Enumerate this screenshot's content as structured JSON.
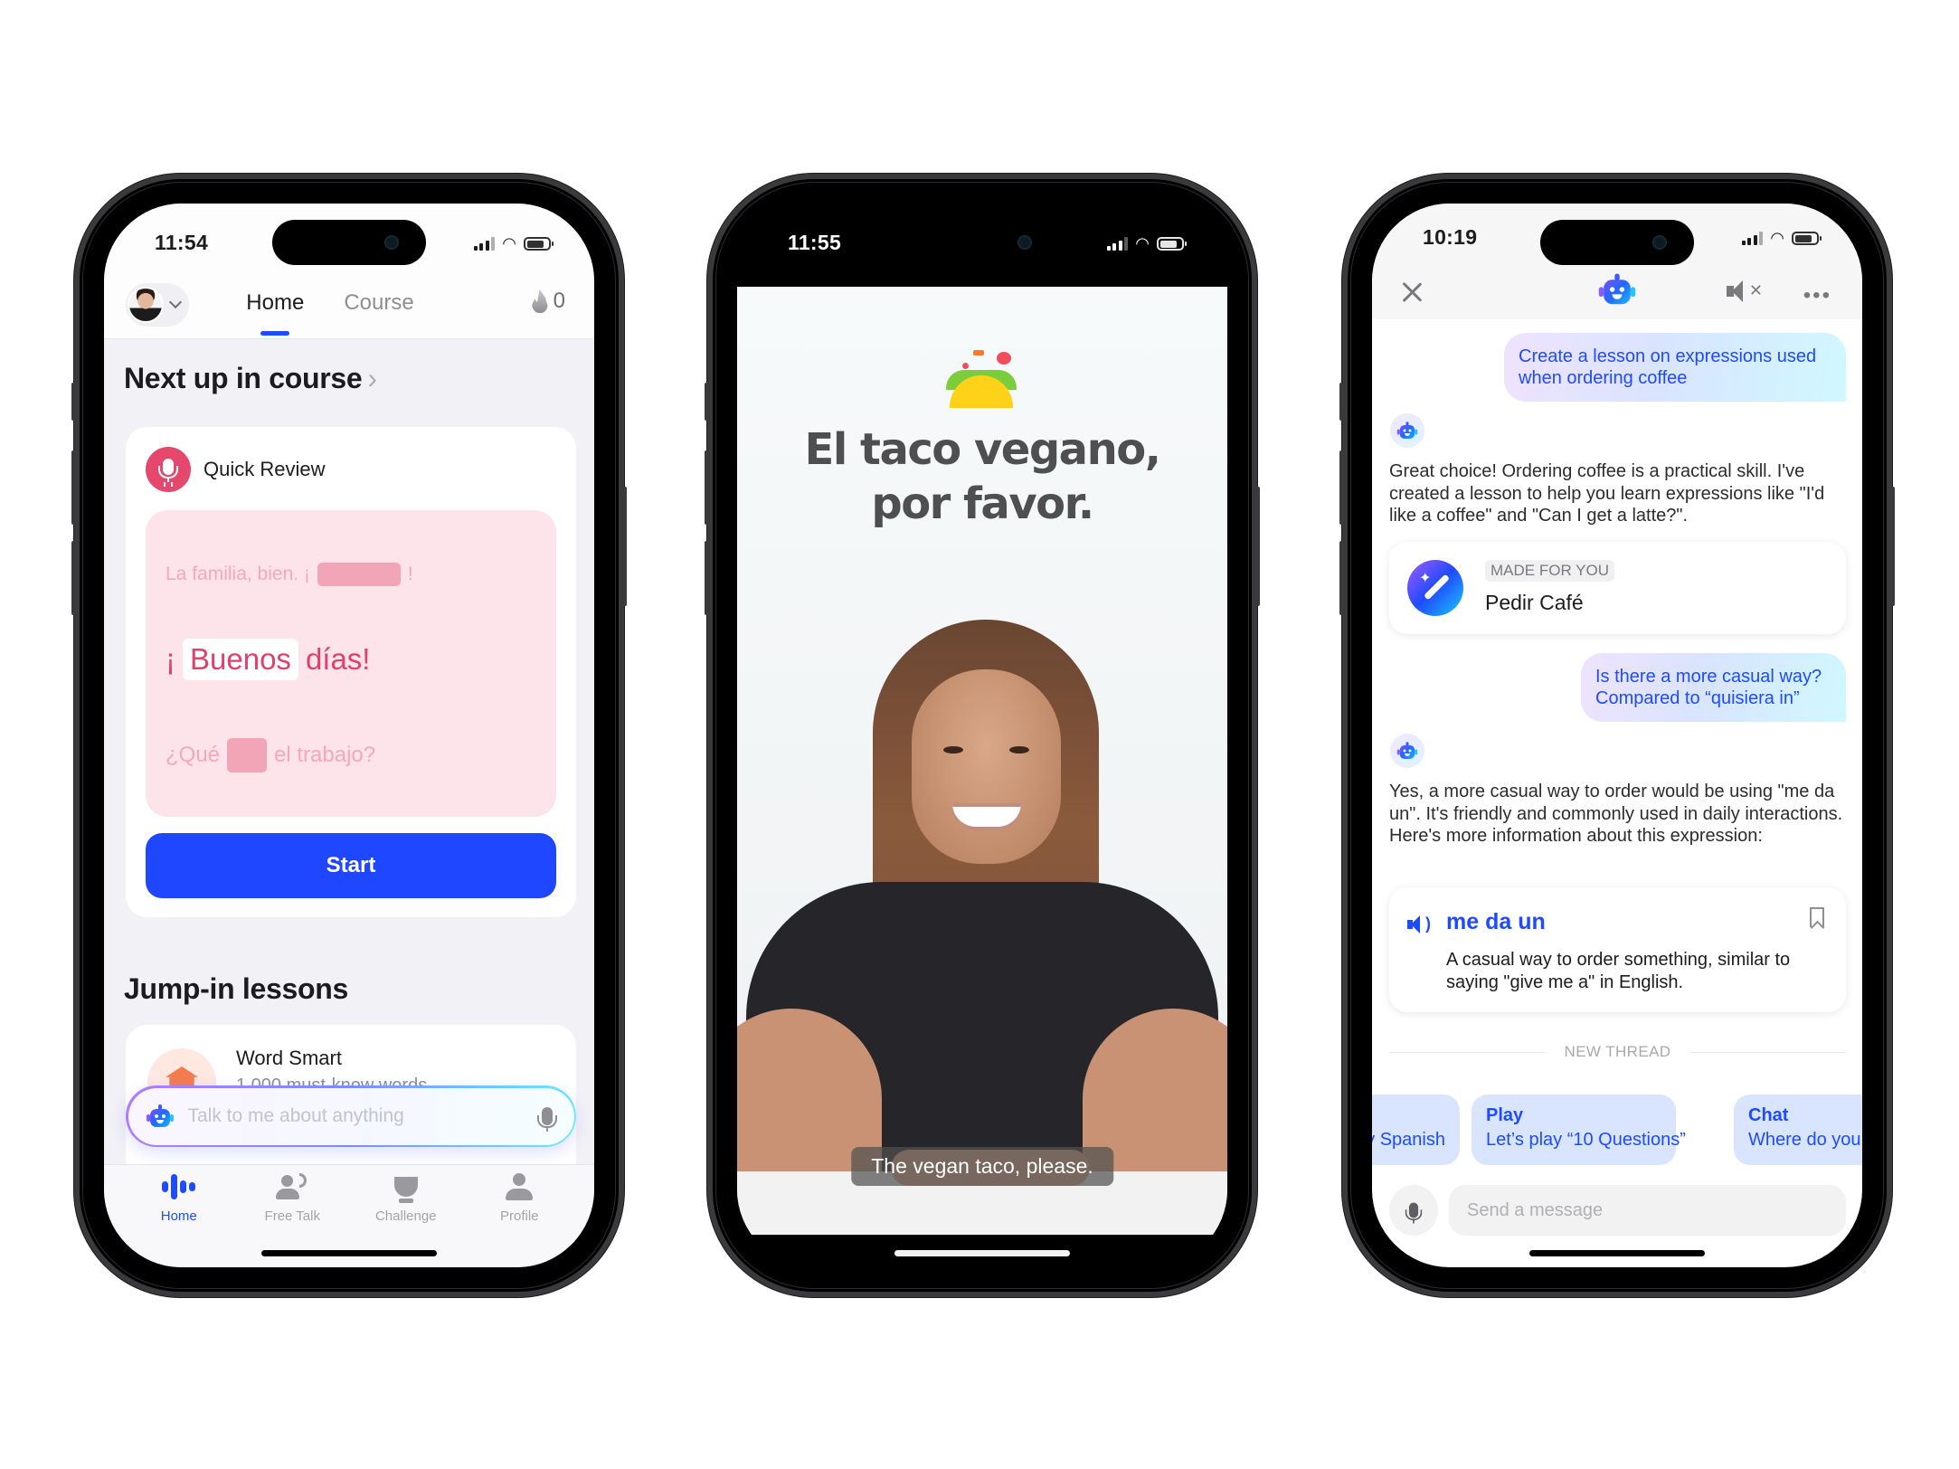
{
  "phones": [
    {
      "status": {
        "time": "11:54"
      },
      "header": {
        "tabs": [
          {
            "label": "Home",
            "active": true
          },
          {
            "label": "Course",
            "active": false
          }
        ],
        "streak_count": "0"
      },
      "next_up": {
        "title": "Next up in course",
        "arrow": "›",
        "card": {
          "label": "Quick Review",
          "line_prev": {
            "before": "La familia, bien. ¡",
            "after": "!"
          },
          "line_main": {
            "before": "¡",
            "word": "Buenos",
            "after": "días!"
          },
          "line_next": {
            "before": "¿Qué",
            "after": "el trabajo?"
          },
          "start_label": "Start"
        }
      },
      "jump_in": {
        "title": "Jump-in lessons",
        "items": [
          {
            "title": "Word Smart",
            "subtitle": "1,000 must-know words"
          }
        ]
      },
      "talk_input": {
        "placeholder": "Talk to me about anything"
      },
      "tabbar": [
        {
          "label": "Home",
          "icon": "waveform-icon",
          "active": true
        },
        {
          "label": "Free Talk",
          "icon": "speaking-person-icon",
          "active": false
        },
        {
          "label": "Challenge",
          "icon": "trophy-icon",
          "active": false
        },
        {
          "label": "Profile",
          "icon": "person-icon",
          "active": false
        }
      ]
    },
    {
      "status": {
        "time": "11:55"
      },
      "video": {
        "emoji": "taco-icon",
        "title_line1": "El taco vegano,",
        "title_line2": "por favor.",
        "caption": "The vegan taco, please."
      }
    },
    {
      "status": {
        "time": "10:19"
      },
      "header": {
        "close": "close-icon",
        "mute": "mute-icon",
        "more": "•••"
      },
      "messages": [
        {
          "role": "user",
          "text": "Create a lesson on expressions used when ordering coffee"
        },
        {
          "role": "bot",
          "text": "Great choice! Ordering coffee is a practical skill. I've created a lesson to help you learn expressions like \"I'd like a coffee\" and \"Can I get a latte?\"."
        },
        {
          "role": "lesson_card",
          "tag": "MADE FOR YOU",
          "title": "Pedir Café"
        },
        {
          "role": "user",
          "text_line1": "Is there a more casual way?",
          "text_line2": "Compared to “quisiera in”"
        },
        {
          "role": "bot",
          "text": "Yes, a more casual way to order would be using \"me da un\". It's friendly and commonly used in daily interactions. Here's more information about this expression:"
        },
        {
          "role": "expression_card",
          "word": "me da un",
          "definition": "A casual way to order something, similar to saying \"give me a\" in English."
        }
      ],
      "divider": "NEW THREAD",
      "chips": [
        {
          "title": "",
          "subtitle": "my Spanish"
        },
        {
          "title": "Play",
          "subtitle": "Let’s play “10 Questions”"
        },
        {
          "title": "Chat",
          "subtitle": "Where do you"
        }
      ],
      "composer": {
        "placeholder": "Send a message"
      }
    }
  ],
  "colors": {
    "accent": "#1f4bff",
    "pink": "#e0416b",
    "pink_bg": "#fde4ea"
  }
}
